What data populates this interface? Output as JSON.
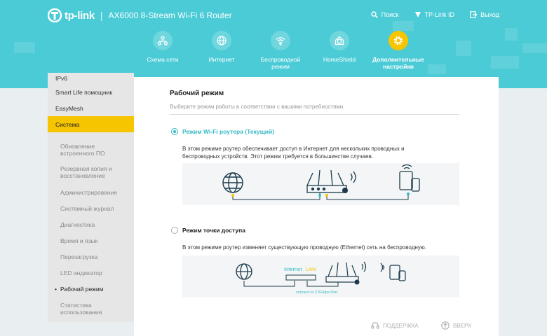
{
  "header": {
    "brand": "tp-link",
    "separator": "|",
    "model": "AX6000 8-Stream Wi-Fi 6 Router",
    "top_links": [
      {
        "icon": "search-icon",
        "label": "Поиск"
      },
      {
        "icon": "tplink-id-icon",
        "label": "TP-Link ID"
      },
      {
        "icon": "logout-icon",
        "label": "Выход"
      }
    ],
    "colors": {
      "bar": "#4acbd6",
      "accent": "#f7c400",
      "link": "#35b9c5"
    }
  },
  "mainnav": [
    {
      "icon": "network-map-icon",
      "label": "Схема сети"
    },
    {
      "icon": "globe-icon",
      "label": "Интернет"
    },
    {
      "icon": "wireless-icon",
      "label": "Беспроводной режим"
    },
    {
      "icon": "homeshield-icon",
      "label": "HomeShield"
    },
    {
      "icon": "gear-icon",
      "label": "Дополнительные настройки",
      "active": true
    }
  ],
  "sidebar": {
    "items": [
      "IPv6",
      "Smart Life помощник",
      "EasyMesh",
      "Система"
    ],
    "active": "Система",
    "subitems": [
      "Обновление встроенного ПО",
      "Резервная копия и восстановление",
      "Администрирование",
      "Системный журнал",
      "Диагностика",
      "Время и язык",
      "Перезагрузка",
      "LED индикатор",
      "Рабочий режим",
      "Статистика использования"
    ],
    "current": "Рабочий режим"
  },
  "content": {
    "title": "Рабочий режим",
    "subtitle": "Выберите режим работы в соответствии с вашими потребностями.",
    "modes": [
      {
        "label": "Режим Wi-Fi роутера (Текущий)",
        "selected": true,
        "description": "В этом режиме роутер обеспечивает доступ в Интернет для нескольких проводных и беспроводных устройств. Этот режим требуется в большинстве случаев."
      },
      {
        "label": "Режим точки доступа",
        "selected": false,
        "description": "В этом режиме роутер изменяет существующую проводную (Ethernet) сеть на беспроводную.",
        "diagram_labels": {
          "internet": "Internet",
          "lan": "LAN",
          "port_note": "connect to 2.5Gbps Port"
        }
      }
    ]
  },
  "footer": {
    "support": "ПОДДЕРЖКА",
    "top": "ВВЕРХ"
  }
}
